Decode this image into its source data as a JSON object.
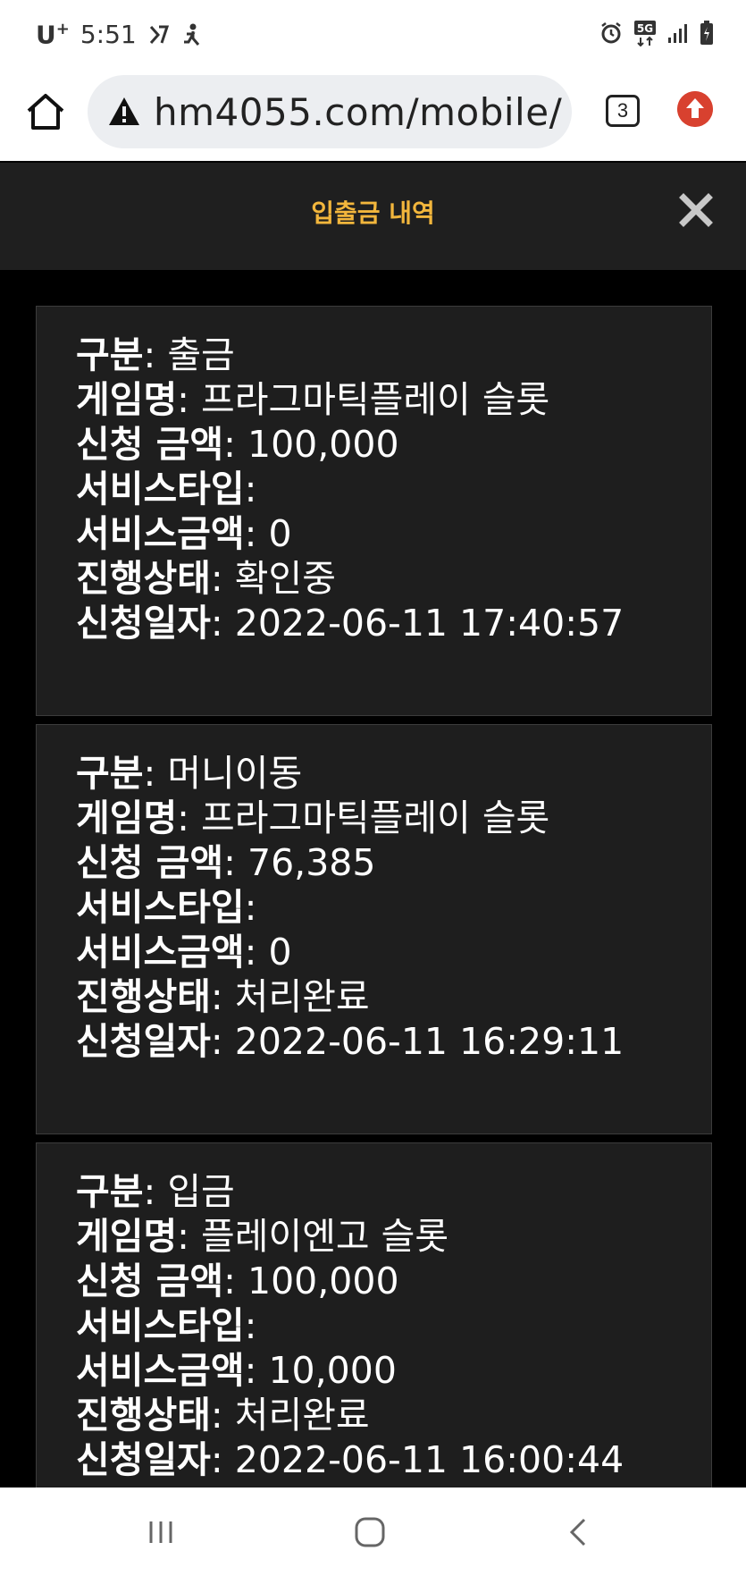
{
  "status_bar": {
    "carrier": "U",
    "carrier_plus": "+",
    "time": "5:51",
    "network": "5G"
  },
  "browser": {
    "url": "hm4055.com/mobile/",
    "tab_count": "3"
  },
  "modal": {
    "title": "입출금 내역"
  },
  "labels": {
    "type": "구분",
    "game": "게임명",
    "amount": "신청 금액",
    "service_type": "서비스타입",
    "service_amount": "서비스금액",
    "status": "진행상태",
    "date": "신청일자"
  },
  "records": [
    {
      "type": "출금",
      "game": "프라그마틱플레이 슬롯",
      "amount": "100,000",
      "service_type": "",
      "service_amount": "0",
      "status": "확인중",
      "date": "2022-06-11 17:40:57"
    },
    {
      "type": "머니이동",
      "game": "프라그마틱플레이 슬롯",
      "amount": "76,385",
      "service_type": "",
      "service_amount": "0",
      "status": "처리완료",
      "date": "2022-06-11 16:29:11"
    },
    {
      "type": "입금",
      "game": "플레이엔고 슬롯",
      "amount": "100,000",
      "service_type": "",
      "service_amount": "10,000",
      "status": "처리완료",
      "date": "2022-06-11 16:00:44"
    }
  ],
  "colors": {
    "accent": "#f2b63c",
    "modal_bg": "#1f1f1f",
    "card_bg": "#1e1e1e"
  }
}
